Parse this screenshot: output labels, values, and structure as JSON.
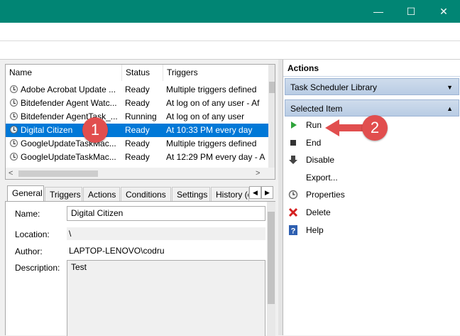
{
  "window": {
    "minimize": "—",
    "maximize": "☐",
    "close": "✕"
  },
  "task_list": {
    "columns": [
      "Name",
      "Status",
      "Triggers"
    ],
    "rows": [
      {
        "name": "Adobe Acrobat Update ...",
        "status": "Ready",
        "trigger": "Multiple triggers defined"
      },
      {
        "name": "Bitdefender Agent Watc...",
        "status": "Ready",
        "trigger": "At log on of any user - Af"
      },
      {
        "name": "Bitdefender AgentTask_...",
        "status": "Running",
        "trigger": "At log on of any user"
      },
      {
        "name": "Digital Citizen",
        "status": "Ready",
        "trigger": "At 10:33 PM every day",
        "selected": true
      },
      {
        "name": "GoogleUpdateTaskMac...",
        "status": "Ready",
        "trigger": "Multiple triggers defined"
      },
      {
        "name": "GoogleUpdateTaskMac...",
        "status": "Ready",
        "trigger": "At 12:29 PM every day - A"
      }
    ]
  },
  "tabs": [
    "General",
    "Triggers",
    "Actions",
    "Conditions",
    "Settings",
    "History (d"
  ],
  "details": {
    "name_label": "Name:",
    "name_value": "Digital Citizen",
    "location_label": "Location:",
    "location_value": "\\",
    "author_label": "Author:",
    "author_value": "LAPTOP-LENOVO\\codru",
    "description_label": "Description:",
    "description_value": "Test"
  },
  "actions_pane": {
    "title": "Actions",
    "library_group": "Task Scheduler Library",
    "selected_group": "Selected Item",
    "items": [
      {
        "label": "Run",
        "icon": "play-icon"
      },
      {
        "label": "End",
        "icon": "stop-icon"
      },
      {
        "label": "Disable",
        "icon": "down-arrow-icon"
      },
      {
        "label": "Export...",
        "icon": ""
      },
      {
        "label": "Properties",
        "icon": "clock-icon"
      },
      {
        "label": "Delete",
        "icon": "delete-x-icon"
      },
      {
        "label": "Help",
        "icon": "help-icon"
      }
    ]
  },
  "markers": [
    "1",
    "2"
  ],
  "colors": {
    "titlebar": "#018574",
    "selection": "#0078d7",
    "marker": "#e14e4e"
  }
}
